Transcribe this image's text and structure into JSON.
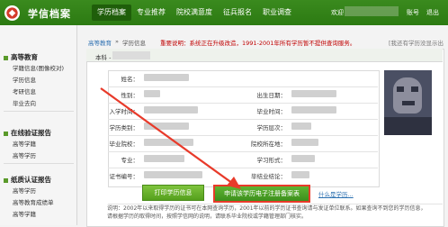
{
  "header": {
    "brand": "学信档案",
    "nav": [
      "学历档案",
      "专业推荐",
      "院校满意度",
      "征兵报名",
      "职业调查"
    ],
    "welcome": "欢迎",
    "links": [
      "账号",
      "退出"
    ]
  },
  "sidebar": {
    "sections": [
      {
        "title": "高等教育",
        "items": [
          "学籍信息(图像校对)",
          "学历信息",
          "考研信息",
          "毕业去向"
        ]
      },
      {
        "title": "在线验证报告",
        "items": [
          "高等学籍",
          "高等学历"
        ]
      },
      {
        "title": "纸质认证报告",
        "items": [
          "高等学历",
          "高等教育成绩单",
          "高等学籍"
        ]
      }
    ]
  },
  "breadcrumb": {
    "home": "高等教育",
    "sep": "»",
    "current": "学历信息"
  },
  "notice": "重要说明：系统正在升级改造，1991-2001年所有学历暂不提供查询服务。",
  "hint": "[我还有学历没显示出来]",
  "tab": {
    "label": "本科 -"
  },
  "fields": {
    "left": [
      "姓名：",
      "性别：",
      "入学时间：",
      "学历类别：",
      "毕业院校：",
      "专业：",
      "证书编号："
    ],
    "right": [
      "出生日期：",
      "毕业时间：",
      "学历层次：",
      "院校所在地：",
      "学习形式：",
      "毕结业结论："
    ]
  },
  "buttons": {
    "print": "打印学历信息",
    "apply": "申请该学历电子注册备案表",
    "what": "什么是学历..."
  },
  "note": {
    "line1": "说明：2002年以来取得学历的证书可在本网查询学历，2001年以前的学历证书查询请与发证单位联系。如果查询不到您的学历信息，",
    "line2": "请根据学历的取得时间，按照学信网的说明，请联系毕业院校或学籍管理部门核实。"
  },
  "colors": {
    "accent": "#3a8a1e",
    "annotation": "#e83a2a",
    "notice": "#c00000"
  }
}
